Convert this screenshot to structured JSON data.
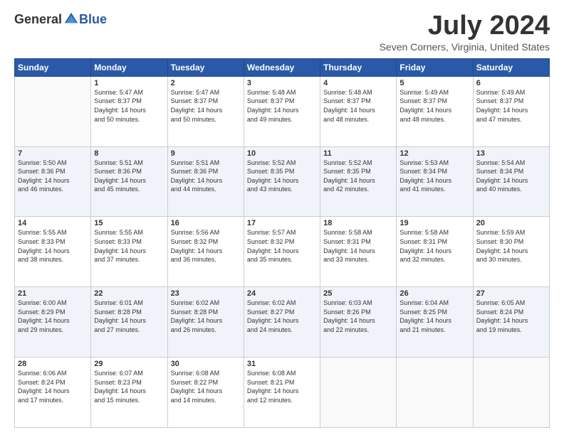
{
  "logo": {
    "general": "General",
    "blue": "Blue"
  },
  "title": "July 2024",
  "location": "Seven Corners, Virginia, United States",
  "days_header": [
    "Sunday",
    "Monday",
    "Tuesday",
    "Wednesday",
    "Thursday",
    "Friday",
    "Saturday"
  ],
  "weeks": [
    [
      {
        "day": "",
        "sunrise": "",
        "sunset": "",
        "daylight": "",
        "empty": true
      },
      {
        "day": "1",
        "sunrise": "Sunrise: 5:47 AM",
        "sunset": "Sunset: 8:37 PM",
        "daylight": "Daylight: 14 hours and 50 minutes."
      },
      {
        "day": "2",
        "sunrise": "Sunrise: 5:47 AM",
        "sunset": "Sunset: 8:37 PM",
        "daylight": "Daylight: 14 hours and 50 minutes."
      },
      {
        "day": "3",
        "sunrise": "Sunrise: 5:48 AM",
        "sunset": "Sunset: 8:37 PM",
        "daylight": "Daylight: 14 hours and 49 minutes."
      },
      {
        "day": "4",
        "sunrise": "Sunrise: 5:48 AM",
        "sunset": "Sunset: 8:37 PM",
        "daylight": "Daylight: 14 hours and 48 minutes."
      },
      {
        "day": "5",
        "sunrise": "Sunrise: 5:49 AM",
        "sunset": "Sunset: 8:37 PM",
        "daylight": "Daylight: 14 hours and 48 minutes."
      },
      {
        "day": "6",
        "sunrise": "Sunrise: 5:49 AM",
        "sunset": "Sunset: 8:37 PM",
        "daylight": "Daylight: 14 hours and 47 minutes."
      }
    ],
    [
      {
        "day": "7",
        "sunrise": "Sunrise: 5:50 AM",
        "sunset": "Sunset: 8:36 PM",
        "daylight": "Daylight: 14 hours and 46 minutes."
      },
      {
        "day": "8",
        "sunrise": "Sunrise: 5:51 AM",
        "sunset": "Sunset: 8:36 PM",
        "daylight": "Daylight: 14 hours and 45 minutes."
      },
      {
        "day": "9",
        "sunrise": "Sunrise: 5:51 AM",
        "sunset": "Sunset: 8:36 PM",
        "daylight": "Daylight: 14 hours and 44 minutes."
      },
      {
        "day": "10",
        "sunrise": "Sunrise: 5:52 AM",
        "sunset": "Sunset: 8:35 PM",
        "daylight": "Daylight: 14 hours and 43 minutes."
      },
      {
        "day": "11",
        "sunrise": "Sunrise: 5:52 AM",
        "sunset": "Sunset: 8:35 PM",
        "daylight": "Daylight: 14 hours and 42 minutes."
      },
      {
        "day": "12",
        "sunrise": "Sunrise: 5:53 AM",
        "sunset": "Sunset: 8:34 PM",
        "daylight": "Daylight: 14 hours and 41 minutes."
      },
      {
        "day": "13",
        "sunrise": "Sunrise: 5:54 AM",
        "sunset": "Sunset: 8:34 PM",
        "daylight": "Daylight: 14 hours and 40 minutes."
      }
    ],
    [
      {
        "day": "14",
        "sunrise": "Sunrise: 5:55 AM",
        "sunset": "Sunset: 8:33 PM",
        "daylight": "Daylight: 14 hours and 38 minutes."
      },
      {
        "day": "15",
        "sunrise": "Sunrise: 5:55 AM",
        "sunset": "Sunset: 8:33 PM",
        "daylight": "Daylight: 14 hours and 37 minutes."
      },
      {
        "day": "16",
        "sunrise": "Sunrise: 5:56 AM",
        "sunset": "Sunset: 8:32 PM",
        "daylight": "Daylight: 14 hours and 36 minutes."
      },
      {
        "day": "17",
        "sunrise": "Sunrise: 5:57 AM",
        "sunset": "Sunset: 8:32 PM",
        "daylight": "Daylight: 14 hours and 35 minutes."
      },
      {
        "day": "18",
        "sunrise": "Sunrise: 5:58 AM",
        "sunset": "Sunset: 8:31 PM",
        "daylight": "Daylight: 14 hours and 33 minutes."
      },
      {
        "day": "19",
        "sunrise": "Sunrise: 5:58 AM",
        "sunset": "Sunset: 8:31 PM",
        "daylight": "Daylight: 14 hours and 32 minutes."
      },
      {
        "day": "20",
        "sunrise": "Sunrise: 5:59 AM",
        "sunset": "Sunset: 8:30 PM",
        "daylight": "Daylight: 14 hours and 30 minutes."
      }
    ],
    [
      {
        "day": "21",
        "sunrise": "Sunrise: 6:00 AM",
        "sunset": "Sunset: 8:29 PM",
        "daylight": "Daylight: 14 hours and 29 minutes."
      },
      {
        "day": "22",
        "sunrise": "Sunrise: 6:01 AM",
        "sunset": "Sunset: 8:28 PM",
        "daylight": "Daylight: 14 hours and 27 minutes."
      },
      {
        "day": "23",
        "sunrise": "Sunrise: 6:02 AM",
        "sunset": "Sunset: 8:28 PM",
        "daylight": "Daylight: 14 hours and 26 minutes."
      },
      {
        "day": "24",
        "sunrise": "Sunrise: 6:02 AM",
        "sunset": "Sunset: 8:27 PM",
        "daylight": "Daylight: 14 hours and 24 minutes."
      },
      {
        "day": "25",
        "sunrise": "Sunrise: 6:03 AM",
        "sunset": "Sunset: 8:26 PM",
        "daylight": "Daylight: 14 hours and 22 minutes."
      },
      {
        "day": "26",
        "sunrise": "Sunrise: 6:04 AM",
        "sunset": "Sunset: 8:25 PM",
        "daylight": "Daylight: 14 hours and 21 minutes."
      },
      {
        "day": "27",
        "sunrise": "Sunrise: 6:05 AM",
        "sunset": "Sunset: 8:24 PM",
        "daylight": "Daylight: 14 hours and 19 minutes."
      }
    ],
    [
      {
        "day": "28",
        "sunrise": "Sunrise: 6:06 AM",
        "sunset": "Sunset: 8:24 PM",
        "daylight": "Daylight: 14 hours and 17 minutes."
      },
      {
        "day": "29",
        "sunrise": "Sunrise: 6:07 AM",
        "sunset": "Sunset: 8:23 PM",
        "daylight": "Daylight: 14 hours and 15 minutes."
      },
      {
        "day": "30",
        "sunrise": "Sunrise: 6:08 AM",
        "sunset": "Sunset: 8:22 PM",
        "daylight": "Daylight: 14 hours and 14 minutes."
      },
      {
        "day": "31",
        "sunrise": "Sunrise: 6:08 AM",
        "sunset": "Sunset: 8:21 PM",
        "daylight": "Daylight: 14 hours and 12 minutes."
      },
      {
        "day": "",
        "sunrise": "",
        "sunset": "",
        "daylight": "",
        "empty": true
      },
      {
        "day": "",
        "sunrise": "",
        "sunset": "",
        "daylight": "",
        "empty": true
      },
      {
        "day": "",
        "sunrise": "",
        "sunset": "",
        "daylight": "",
        "empty": true
      }
    ]
  ]
}
